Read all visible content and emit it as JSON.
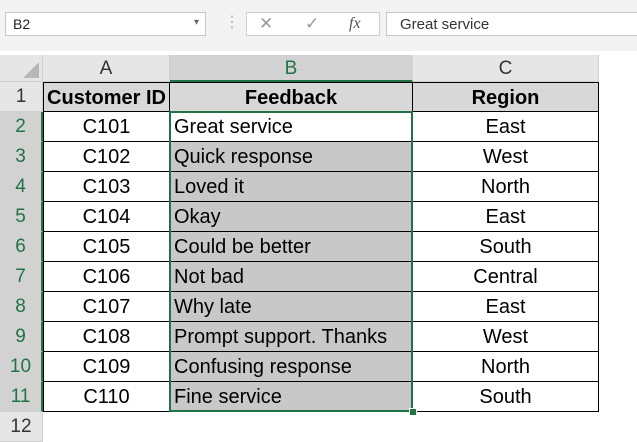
{
  "formula_bar": {
    "name_box": "B2",
    "name_box_caret": "▾",
    "separator": "⋮",
    "cancel_glyph": "✕",
    "enter_glyph": "✓",
    "fx_label": "fx",
    "formula_value": "Great service"
  },
  "sheet": {
    "columns": [
      "A",
      "B",
      "C"
    ],
    "rows": [
      "1",
      "2",
      "3",
      "4",
      "5",
      "6",
      "7",
      "8",
      "9",
      "10",
      "11",
      "12"
    ],
    "header": [
      "Customer ID",
      "Feedback",
      "Region"
    ],
    "data": [
      [
        "C101",
        "Great service",
        "East"
      ],
      [
        "C102",
        "Quick response",
        "West"
      ],
      [
        "C103",
        "Loved it",
        "North"
      ],
      [
        "C104",
        "Okay",
        "East"
      ],
      [
        "C105",
        "Could be better",
        "South"
      ],
      [
        "C106",
        "Not bad",
        "Central"
      ],
      [
        "C107",
        "Why late",
        "East"
      ],
      [
        "C108",
        "Prompt support. Thanks",
        "West"
      ],
      [
        "C109",
        "Confusing response",
        "North"
      ],
      [
        "C110",
        "Fine service",
        "South"
      ]
    ],
    "active_cell": "B2",
    "selection": "B2:B11",
    "colors": {
      "accent": "#217346",
      "selection_fill": "#c8c8c8",
      "header_fill": "#d8d8d8"
    }
  }
}
